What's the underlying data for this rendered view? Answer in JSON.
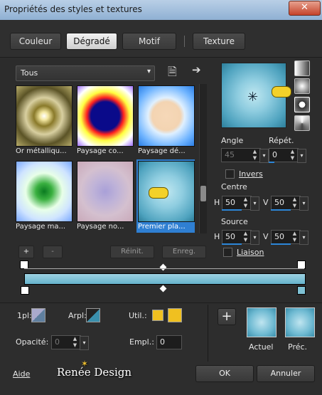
{
  "window": {
    "title": "Propriétés des styles et textures",
    "close_label": "✕"
  },
  "tabs": [
    {
      "label": "Couleur",
      "active": false
    },
    {
      "label": "Dégradé",
      "active": true
    },
    {
      "label": "Motif",
      "active": false
    },
    {
      "label": "Texture",
      "active": false
    }
  ],
  "category": {
    "value": "Tous"
  },
  "gradients": [
    {
      "label": "Or métalliqu...",
      "selected": false
    },
    {
      "label": "Paysage co...",
      "selected": false
    },
    {
      "label": "Paysage dé...",
      "selected": false
    },
    {
      "label": "Paysage ma...",
      "selected": false
    },
    {
      "label": "Paysage no...",
      "selected": false
    },
    {
      "label": "Premier pla...",
      "selected": true
    }
  ],
  "list_buttons": {
    "add": "+",
    "remove": "-",
    "reset": "Réinit.",
    "save": "Enreg."
  },
  "angle": {
    "label": "Angle",
    "value": "45"
  },
  "repeat": {
    "label": "Répét.",
    "value": "0"
  },
  "invert": {
    "label": "Invers",
    "checked": false
  },
  "center": {
    "label": "Centre",
    "h_label": "H",
    "h": "50",
    "v_label": "V",
    "v": "50"
  },
  "source": {
    "label": "Source",
    "h_label": "H",
    "h": "50",
    "v_label": "V",
    "v": "50"
  },
  "link": {
    "label": "Liaison",
    "checked": false
  },
  "editor": {
    "opacity_label": "1pl:",
    "arpl_label": "Arpl:",
    "util_label": "Util.:",
    "opacite_label": "Opacité:",
    "opacite_value": "0",
    "empl_label": "Empl.:",
    "empl_value": "0"
  },
  "preview": {
    "actual_label": "Actuel",
    "prev_label": "Préc.",
    "add": "+"
  },
  "footer": {
    "help": "Aide",
    "brand": "Renée Design",
    "ok": "OK",
    "cancel": "Annuler"
  },
  "colors": {
    "accent": "#2c86d8",
    "selection": "#2f7fd2",
    "gradient_light": "#9dd2e2",
    "gradient_dark": "#3a8fac",
    "yellow": "#f0c020"
  }
}
